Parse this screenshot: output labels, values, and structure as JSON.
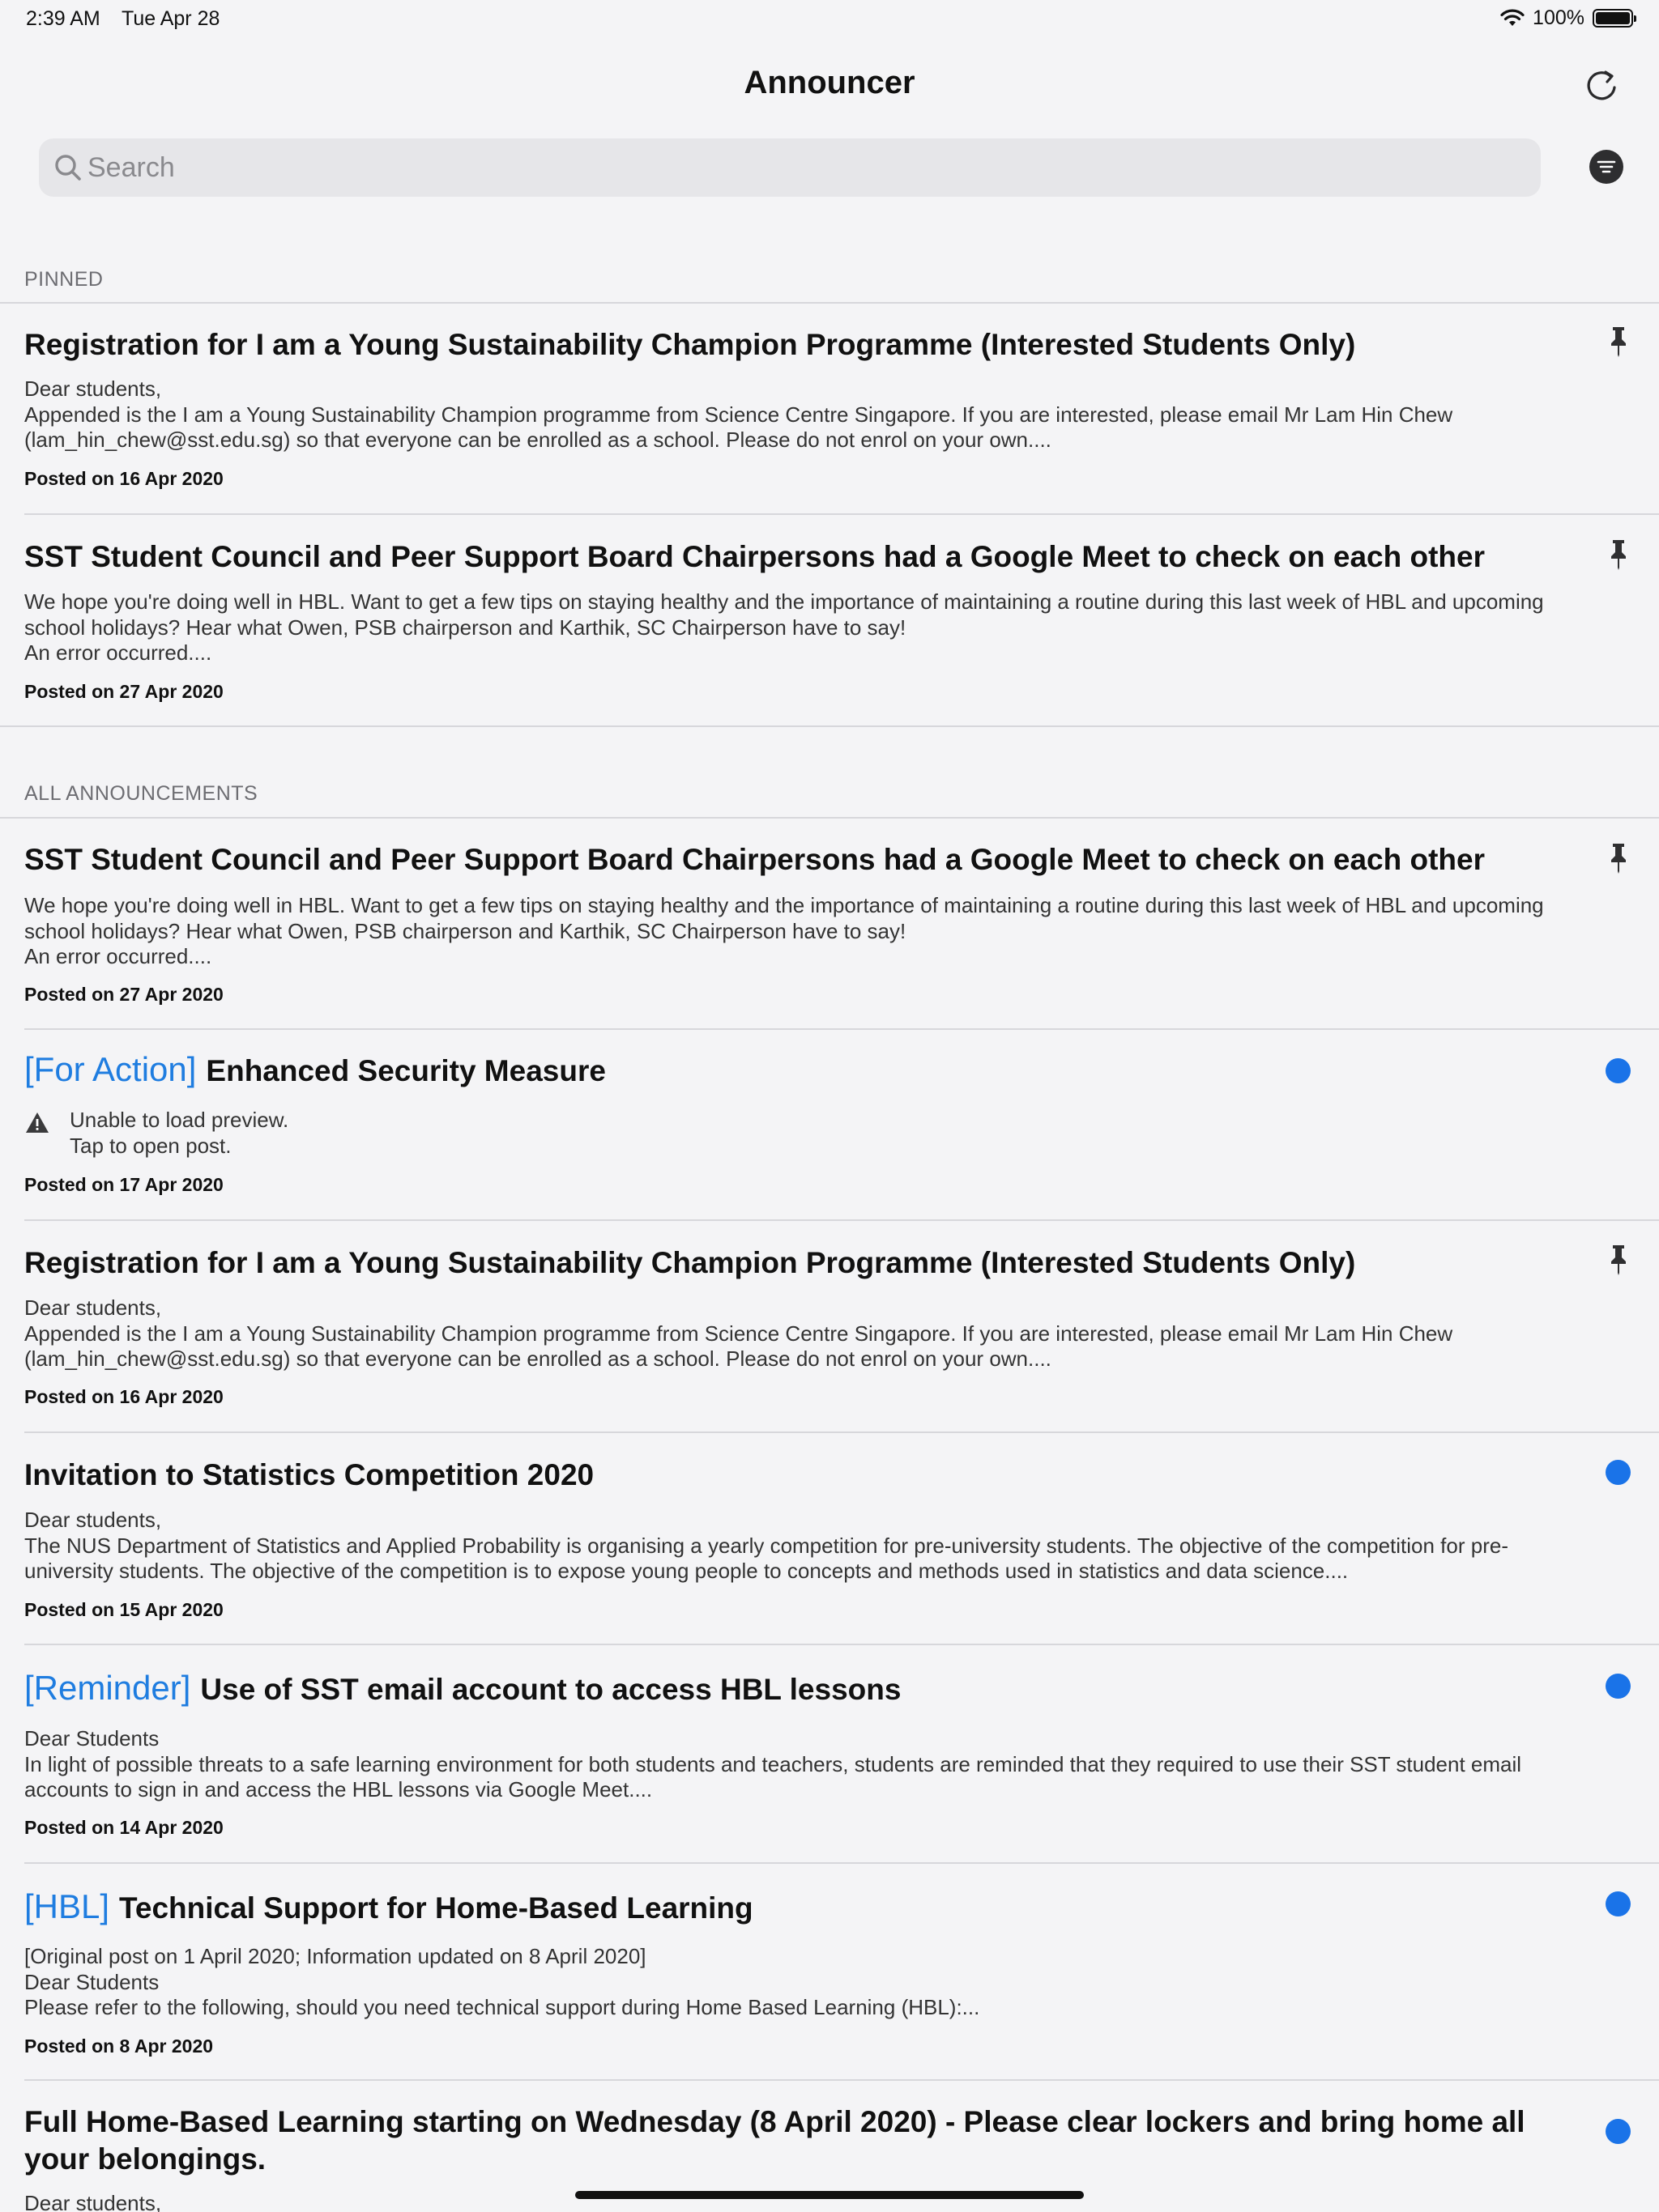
{
  "status_bar": {
    "time": "2:39 AM",
    "date": "Tue Apr 28",
    "battery": "100%",
    "battery_level": 1.0
  },
  "nav": {
    "title": "Announcer"
  },
  "search": {
    "placeholder": "Search"
  },
  "sections": {
    "pinned": "PINNED",
    "all": "ALL ANNOUNCEMENTS"
  },
  "pinned_posts": [
    {
      "title": "Registration for I am a Young Sustainability Champion Programme (Interested Students Only)",
      "body": "Dear students,\nAppended is the I am a Young Sustainability Champion programme from Science Centre Singapore. If you are interested, please email Mr Lam Hin Chew (lam_hin_chew@sst.edu.sg) so that everyone can be enrolled as a school. Please do not enrol on your own....",
      "date": "Posted on 16 Apr 2020"
    },
    {
      "title": "SST Student Council and Peer Support Board Chairpersons had a Google Meet to check on each other",
      "body": "We hope you're doing well in HBL. Want to get a few tips on staying healthy and the importance of maintaining a routine during this last week of HBL and upcoming school holidays? Hear what Owen, PSB chairperson and Karthik, SC Chairperson have to say!\nAn error occurred....",
      "date": "Posted on 27 Apr 2020"
    }
  ],
  "all_posts": [
    {
      "title": "SST Student Council and Peer Support Board Chairpersons had a Google Meet to check on each other",
      "body": "We hope you're doing well in HBL. Want to get a few tips on staying healthy and the importance of maintaining a routine during this last week of HBL and upcoming school holidays? Hear what Owen, PSB chairperson and Karthik, SC Chairperson have to say!\nAn error occurred....",
      "date": "Posted on 27 Apr 2020"
    },
    {
      "tag": "[For Action]",
      "title": "Enhanced Security Measure",
      "error_line1": "Unable to load preview.",
      "error_line2": "Tap to open post.",
      "date": "Posted on 17 Apr 2020"
    },
    {
      "title": "Registration for I am a Young Sustainability Champion Programme (Interested Students Only)",
      "body": "Dear students,\nAppended is the I am a Young Sustainability Champion programme from Science Centre Singapore. If you are interested, please email Mr Lam Hin Chew (lam_hin_chew@sst.edu.sg) so that everyone can be enrolled as a school. Please do not enrol on your own....",
      "date": "Posted on 16 Apr 2020"
    },
    {
      "title": "Invitation to Statistics Competition 2020",
      "body": "Dear students,\nThe NUS Department of Statistics and Applied Probability is organising a yearly competition for pre-university students. The objective of the competition for pre-university students. The objective of the competition is to expose young people to concepts and methods used in statistics and data science....",
      "date": "Posted on 15 Apr 2020"
    },
    {
      "tag": "[Reminder]",
      "title": "Use of SST email account to access HBL lessons",
      "body": "Dear Students\nIn light of possible threats to a safe learning environment for both students and teachers, students are reminded that they required to use their SST student email accounts to sign in and access the HBL lessons via Google Meet....",
      "date": "Posted on 14 Apr 2020"
    },
    {
      "tag": "[HBL]",
      "title": "Technical Support for Home-Based Learning",
      "body": "[Original post on 1 April 2020; Information updated on 8 April 2020]\nDear Students\nPlease refer to the following, should you need technical support during Home Based Learning (HBL):...",
      "date": "Posted on 8 Apr 2020"
    },
    {
      "title": "Full Home-Based Learning starting on Wednesday (8 April 2020) - Please clear lockers and bring home all your belongings.",
      "body": "Dear students,"
    }
  ],
  "colors": {
    "tag": "#1f7de0",
    "unread_dot": "#1a73e8",
    "background": "#f4f4f6"
  },
  "icons": [
    "refresh-icon",
    "search-icon",
    "filter-icon",
    "pin-icon",
    "unread-dot-icon",
    "warning-icon",
    "wifi-icon",
    "battery-icon"
  ]
}
